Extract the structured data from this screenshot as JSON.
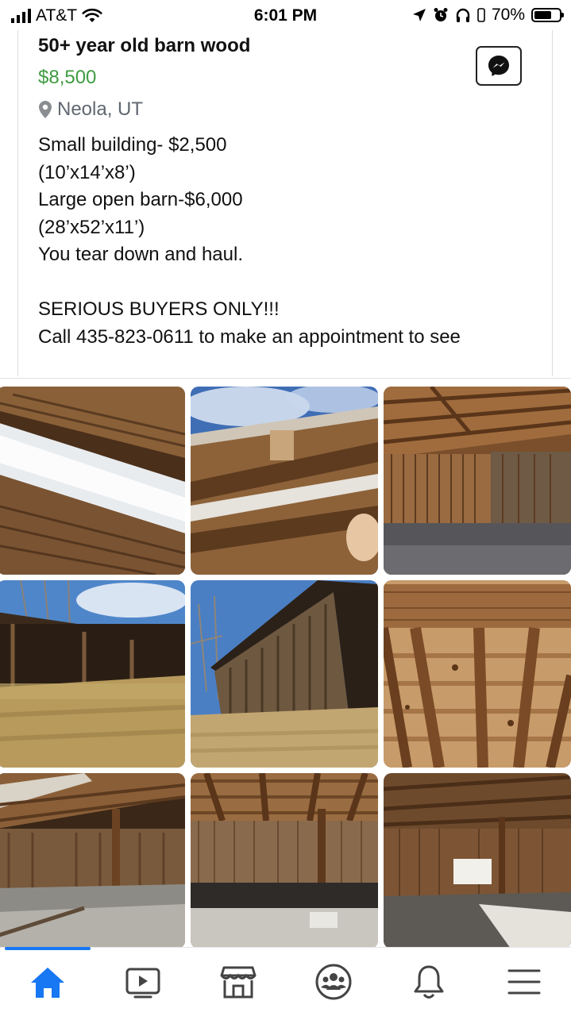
{
  "status_bar": {
    "carrier": "AT&T",
    "time": "6:01 PM",
    "battery": "70%",
    "battery_level": 0.7
  },
  "listing": {
    "title": "50+ year old barn wood",
    "price": "$8,500",
    "location": "Neola, UT",
    "description": "Small building- $2,500\n(10’x14’x8’)\nLarge open barn-$6,000\n(28’x52’x11’)\nYou tear down and haul.\n\nSERIOUS BUYERS ONLY!!!\nCall 435-823-0611 to make an appointment to see"
  },
  "icons": {
    "messenger": "messenger-icon",
    "location": "map-pin-icon",
    "home": "home-icon",
    "watch": "video-icon",
    "marketplace": "marketplace-icon",
    "groups": "groups-icon",
    "notifications": "bell-icon",
    "menu": "menu-icon"
  },
  "colors": {
    "price": "#3f9c42",
    "active_tab": "#1877f2",
    "inactive_tab": "#65676b"
  },
  "photos": [
    "barn wood close-up with snow",
    "barn wall against blue sky",
    "barn interior with wooden walls",
    "open barn with dry grass",
    "leaning barn shed",
    "wooden ceiling beams",
    "barn interior with posts",
    "barn interior with center post",
    "barn interior with window"
  ]
}
